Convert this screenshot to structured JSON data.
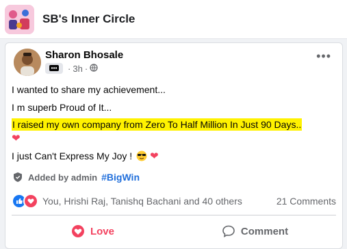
{
  "group": {
    "name": "SB's Inner Circle"
  },
  "post": {
    "author": "Sharon Bhosale",
    "time": "3h",
    "lines": [
      "I wanted to share my achievement...",
      "I m superb Proud of It...",
      "I raised my own company from Zero To Half Million In Just 90 Days..",
      "I just Can't Express My Joy !"
    ],
    "added_by": "Added by admin",
    "hashtag": "#BigWin"
  },
  "reactions": {
    "summary": "You, Hrishi Raj, Tanishq Bachani and 40 others",
    "comments": "21 Comments"
  },
  "actions": {
    "love": "Love",
    "comment": "Comment"
  },
  "colors": {
    "accent": "#216fdb",
    "love": "#f3425f",
    "highlight": "#fff200"
  }
}
